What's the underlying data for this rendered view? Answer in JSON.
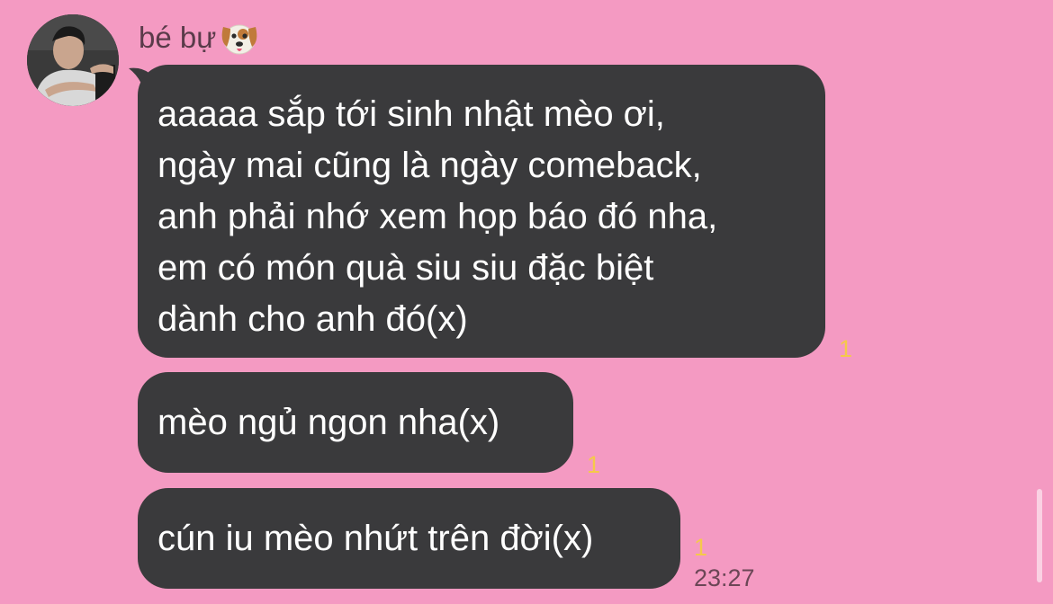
{
  "chat": {
    "sender_name": "bé bự",
    "sender_emoji": "dog-face-icon",
    "avatar": "contact-avatar-photo",
    "messages": [
      {
        "text": "aaaaa sắp tới sinh nhật mèo ơi,\nngày mai cũng là ngày comeback,\nanh phải nhớ xem họp báo đó nha,\nem có món quà siu siu đặc biệt\ndành cho anh đó(x)",
        "read_count": "1"
      },
      {
        "text": "mèo ngủ ngon nha(x)",
        "read_count": "1"
      },
      {
        "text": "cún iu mèo nhứt trên đời(x)",
        "read_count": "1",
        "time": "23:27"
      }
    ]
  },
  "colors": {
    "background": "#f49ac2",
    "bubble": "#3a3a3c",
    "bubble_text": "#ffffff",
    "read_count": "#f5c94a",
    "time": "#6b4656"
  }
}
